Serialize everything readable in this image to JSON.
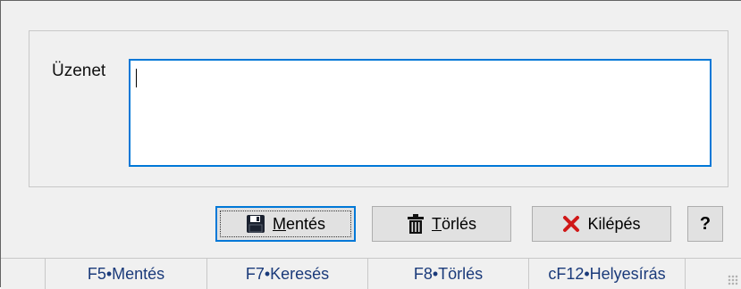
{
  "form": {
    "message_label": "Üzenet",
    "message_value": ""
  },
  "buttons": {
    "save": {
      "label_ul": "M",
      "label_rest": "entés",
      "icon": "floppy-disk-icon"
    },
    "delete": {
      "label_ul": "T",
      "label_rest": "örlés",
      "icon": "trash-icon"
    },
    "exit": {
      "label": "Kilépés",
      "icon": "red-x-icon"
    },
    "help": {
      "label": "?"
    }
  },
  "fkeys": [
    "F5•Mentés",
    "F7•Keresés",
    "F8•Törlés",
    "cF12•Helyesírás"
  ],
  "colors": {
    "focus_blue": "#0078d7",
    "fkey_text": "#1a3a7a",
    "exit_icon_red": "#d01818"
  }
}
